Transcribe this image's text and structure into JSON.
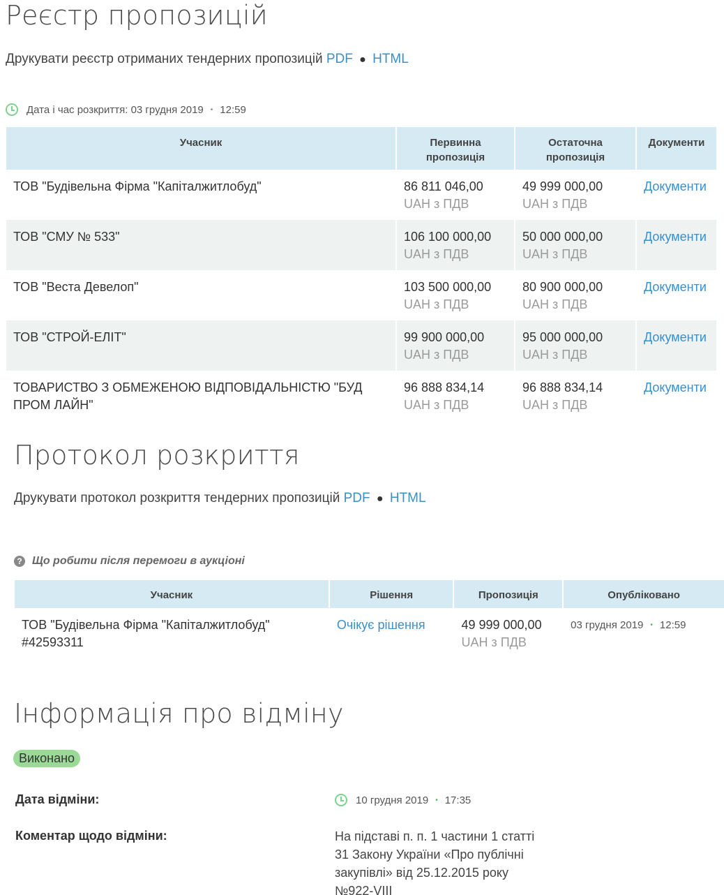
{
  "registry": {
    "title": "Реєстр пропозицій",
    "print_text": "Друкувати реєстр отриманих тендерних пропозицій",
    "pdf": "PDF",
    "sep": "●",
    "html": "HTML",
    "opening_label": "Дата і час розкриття: 03 грудня 2019",
    "opening_bullet": "•",
    "opening_time": "12:59",
    "headers": {
      "participant": "Учасник",
      "initial_1": "Первинна",
      "initial_2": "пропозиція",
      "final_1": "Остаточна",
      "final_2": "пропозиція",
      "documents": "Документи"
    },
    "rows": [
      {
        "participant_1": "ТОВ \"Будівельна Фірма \"Капіталжитлобуд\"",
        "participant_2": "",
        "initial": "86 811 046,00",
        "final": "49 999 000,00",
        "vat": "UAH з ПДВ",
        "docs": "Документи"
      },
      {
        "participant_1": "ТОВ \"СМУ № 533\"",
        "participant_2": "",
        "initial": "106 100 000,00",
        "final": "50 000 000,00",
        "vat": "UAH з ПДВ",
        "docs": "Документи"
      },
      {
        "participant_1": "ТОВ \"Веста Девелоп\"",
        "participant_2": "",
        "initial": "103 500 000,00",
        "final": "80 900 000,00",
        "vat": "UAH з ПДВ",
        "docs": "Документи"
      },
      {
        "participant_1": "ТОВ \"СТРОЙ-ЕЛІТ\"",
        "participant_2": "",
        "initial": "99 900 000,00",
        "final": "95 000 000,00",
        "vat": "UAH з ПДВ",
        "docs": "Документи"
      },
      {
        "participant_1": "ТОВАРИСТВО З ОБМЕЖЕНОЮ ВІДПОВІДАЛЬНІСТЮ \"БУД",
        "participant_2": "ПРОМ ЛАЙН\"",
        "initial": "96 888 834,14",
        "final": "96 888 834,14",
        "vat": "UAH з ПДВ",
        "docs": "Документи"
      }
    ]
  },
  "protocol": {
    "title": "Протокол розкриття",
    "print_text": "Друкувати протокол розкриття тендерних пропозицій",
    "pdf": "PDF",
    "sep": "●",
    "html": "HTML",
    "help": "Що робити після перемоги в аукціоні",
    "headers": {
      "participant": "Учасник",
      "decision": "Рішення",
      "offer": "Пропозиція",
      "published": "Опубліковано"
    },
    "row": {
      "participant_1": "ТОВ \"Будівельна Фірма \"Капіталжитлобуд\"",
      "participant_2": "#42593311",
      "decision": "Очікує рішення",
      "offer": "49 999 000,00",
      "vat": "UAH з ПДВ",
      "date": "03 грудня 2019",
      "bullet": "•",
      "time": "12:59"
    }
  },
  "cancellation": {
    "title": "Інформація про відміну",
    "status": "Виконано",
    "date_label": "Дата відміни:",
    "date": "10 грудня 2019",
    "bullet": "•",
    "time": "17:35",
    "comment_label": "Коментар щодо відміни:",
    "comment_1": "На підставі п. п. 1 частини 1 статті",
    "comment_2": "31 Закону України «Про публічні",
    "comment_3": "закупівлі» від 25.12.2015 року",
    "comment_4": "№922-VIII"
  },
  "colors": {
    "link": "#3a8fc9",
    "header_bg": "#d5eaf2",
    "alt_row_bg": "#eef2f0",
    "badge_bg": "#9bd996",
    "clock": "#7ed18e"
  }
}
